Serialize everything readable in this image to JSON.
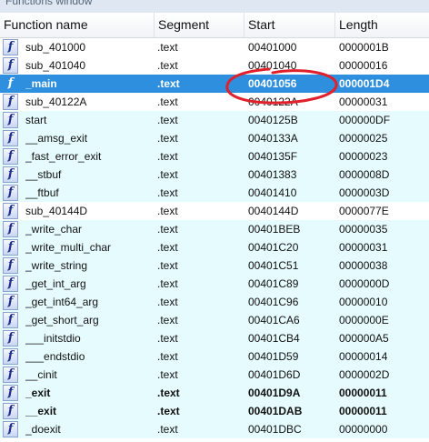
{
  "window": {
    "title": "Functions window"
  },
  "columns": {
    "name": "Function name",
    "segment": "Segment",
    "start": "Start",
    "length": "Length"
  },
  "icon_glyph": "f",
  "rows": [
    {
      "name": "sub_401000",
      "segment": ".text",
      "start": "00401000",
      "length": "0000001B",
      "style": "normal"
    },
    {
      "name": "sub_401040",
      "segment": ".text",
      "start": "00401040",
      "length": "00000016",
      "style": "normal"
    },
    {
      "name": "_main",
      "segment": ".text",
      "start": "00401056",
      "length": "000001D4",
      "style": "selected"
    },
    {
      "name": "sub_40122A",
      "segment": ".text",
      "start": "0040122A",
      "length": "00000031",
      "style": "normal"
    },
    {
      "name": "start",
      "segment": ".text",
      "start": "0040125B",
      "length": "000000DF",
      "style": "lib"
    },
    {
      "name": "__amsg_exit",
      "segment": ".text",
      "start": "0040133A",
      "length": "00000025",
      "style": "lib"
    },
    {
      "name": "_fast_error_exit",
      "segment": ".text",
      "start": "0040135F",
      "length": "00000023",
      "style": "lib"
    },
    {
      "name": "__stbuf",
      "segment": ".text",
      "start": "00401383",
      "length": "0000008D",
      "style": "lib"
    },
    {
      "name": "__ftbuf",
      "segment": ".text",
      "start": "00401410",
      "length": "0000003D",
      "style": "lib"
    },
    {
      "name": "sub_40144D",
      "segment": ".text",
      "start": "0040144D",
      "length": "0000077E",
      "style": "normal"
    },
    {
      "name": "_write_char",
      "segment": ".text",
      "start": "00401BEB",
      "length": "00000035",
      "style": "lib"
    },
    {
      "name": "_write_multi_char",
      "segment": ".text",
      "start": "00401C20",
      "length": "00000031",
      "style": "lib"
    },
    {
      "name": "_write_string",
      "segment": ".text",
      "start": "00401C51",
      "length": "00000038",
      "style": "lib"
    },
    {
      "name": "_get_int_arg",
      "segment": ".text",
      "start": "00401C89",
      "length": "0000000D",
      "style": "lib"
    },
    {
      "name": "_get_int64_arg",
      "segment": ".text",
      "start": "00401C96",
      "length": "00000010",
      "style": "lib"
    },
    {
      "name": "_get_short_arg",
      "segment": ".text",
      "start": "00401CA6",
      "length": "0000000E",
      "style": "lib"
    },
    {
      "name": "___initstdio",
      "segment": ".text",
      "start": "00401CB4",
      "length": "000000A5",
      "style": "lib"
    },
    {
      "name": "___endstdio",
      "segment": ".text",
      "start": "00401D59",
      "length": "00000014",
      "style": "lib"
    },
    {
      "name": "__cinit",
      "segment": ".text",
      "start": "00401D6D",
      "length": "0000002D",
      "style": "lib"
    },
    {
      "name": "_exit",
      "segment": ".text",
      "start": "00401D9A",
      "length": "00000011",
      "style": "bold-lib"
    },
    {
      "name": "__exit",
      "segment": ".text",
      "start": "00401DAB",
      "length": "00000011",
      "style": "bold-lib"
    },
    {
      "name": "_doexit",
      "segment": ".text",
      "start": "00401DBC",
      "length": "00000000",
      "style": "lib"
    }
  ],
  "colors": {
    "selection": "#2f8fdf",
    "library_row": "#e6fbfd",
    "annotation_circle": "#e0202a"
  }
}
